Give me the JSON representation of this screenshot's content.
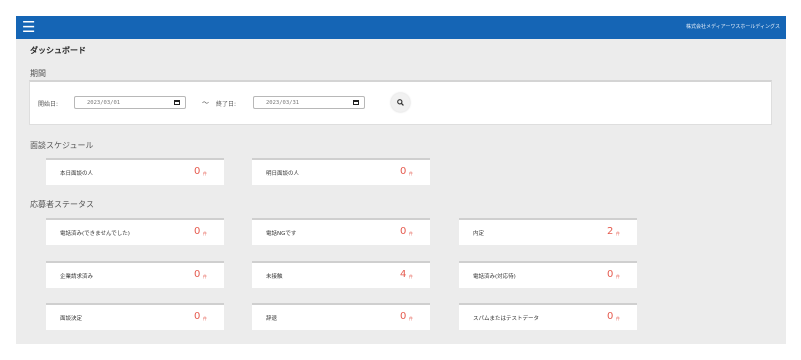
{
  "header": {
    "menu_icon": "hamburger-icon",
    "company_name": "株式会社メディアーワスホールディングス",
    "bar_color": "#1565b5"
  },
  "page_title": "ダッシュボード",
  "period": {
    "section_title": "期間",
    "start_label": "開始日:",
    "start_value": "2023/03/01",
    "separator": "〜",
    "end_label": "終了日:",
    "end_value": "2023/03/31",
    "search_icon": "search-icon"
  },
  "interview": {
    "section_title": "面談スケジュール",
    "cards": [
      {
        "label": "本日面談の人",
        "value": "0",
        "unit": "件"
      },
      {
        "label": "明日面談の人",
        "value": "0",
        "unit": "件"
      }
    ]
  },
  "applicant": {
    "section_title": "応募者ステータス",
    "cards": [
      {
        "label": "電話済み(できませんでした)",
        "value": "0",
        "unit": "件"
      },
      {
        "label": "電話NGです",
        "value": "0",
        "unit": "件"
      },
      {
        "label": "内定",
        "value": "2",
        "unit": "件"
      },
      {
        "label": "企業請求済み",
        "value": "0",
        "unit": "件"
      },
      {
        "label": "未接触",
        "value": "4",
        "unit": "件"
      },
      {
        "label": "電話済み(対応待)",
        "value": "0",
        "unit": "件"
      },
      {
        "label": "面談決定",
        "value": "0",
        "unit": "件"
      },
      {
        "label": "辞退",
        "value": "0",
        "unit": "件"
      },
      {
        "label": "スパムまたはテストデータ",
        "value": "0",
        "unit": "件"
      }
    ]
  },
  "colors": {
    "count_accent": "#e55a4e"
  }
}
